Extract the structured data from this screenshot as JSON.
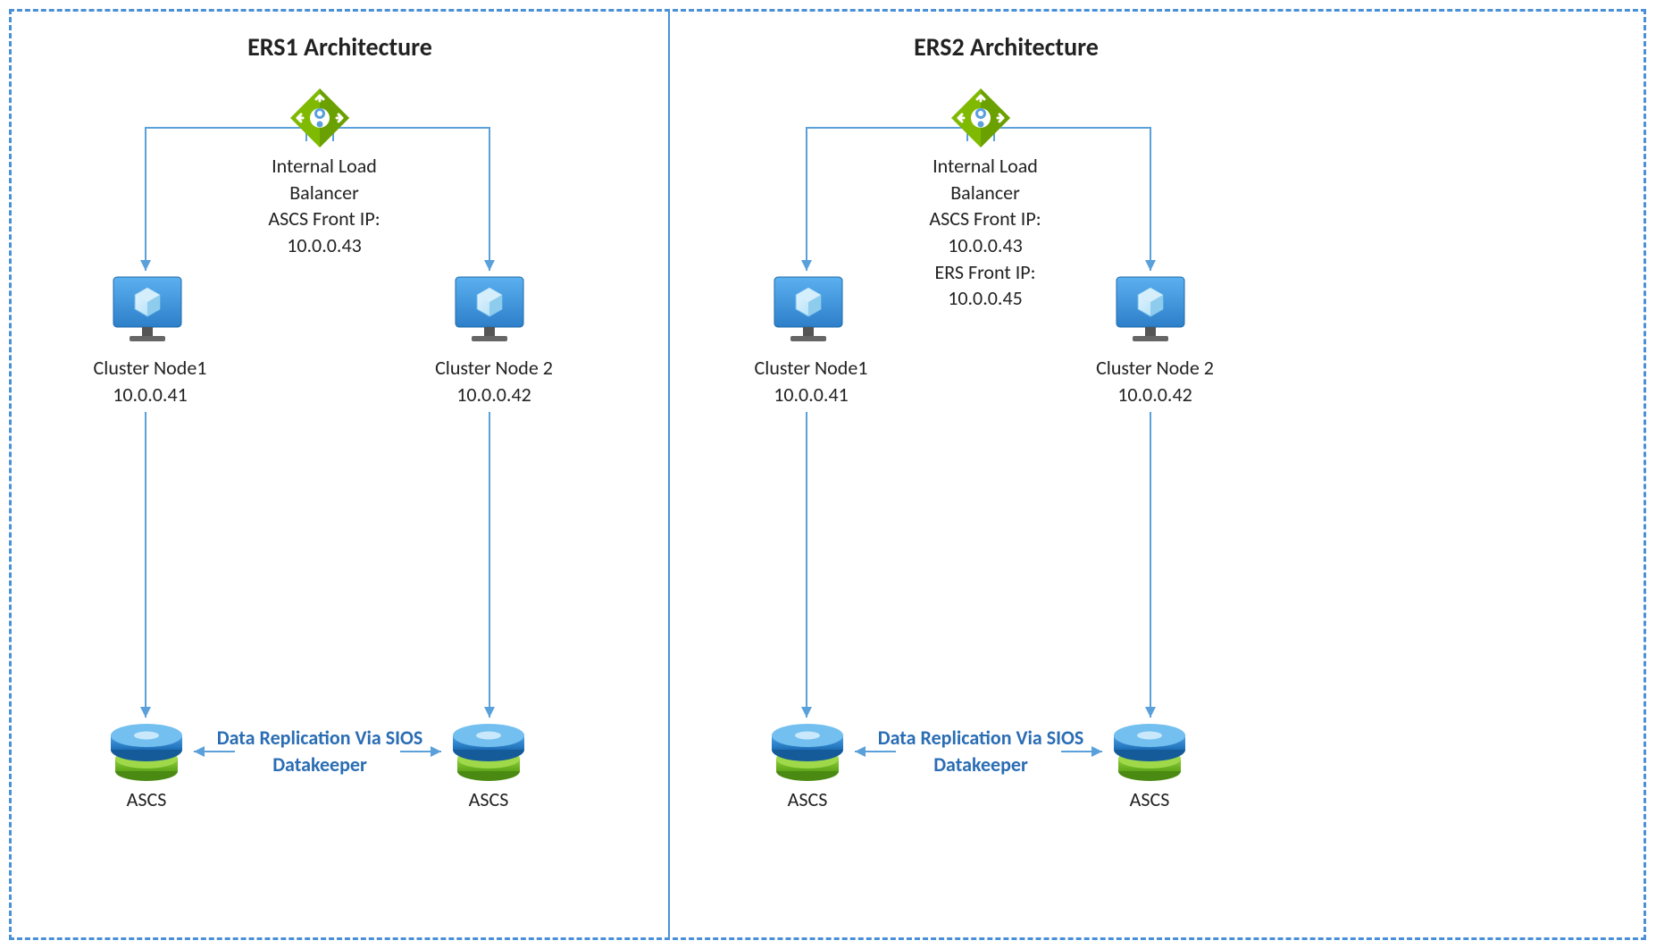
{
  "panels": {
    "ers1": {
      "title": "ERS1 Architecture",
      "loadBalancer": "Internal Load\nBalancer\nASCS Front IP:\n10.0.0.43",
      "node1": "Cluster Node1\n10.0.0.41",
      "node2": "Cluster Node 2\n10.0.0.42",
      "replication": "Data Replication\nVia SIOS Datakeeper",
      "disk1": "ASCS",
      "disk2": "ASCS"
    },
    "ers2": {
      "title": "ERS2 Architecture",
      "loadBalancer": "Internal Load\nBalancer\nASCS Front IP:\n10.0.0.43\nERS Front IP:\n10.0.0.45",
      "node1": "Cluster Node1\n10.0.0.41",
      "node2": "Cluster Node 2\n10.0.0.42",
      "replication": "Data Replication\nVia SIOS Datakeeper",
      "disk1": "ASCS",
      "disk2": "ASCS"
    }
  }
}
